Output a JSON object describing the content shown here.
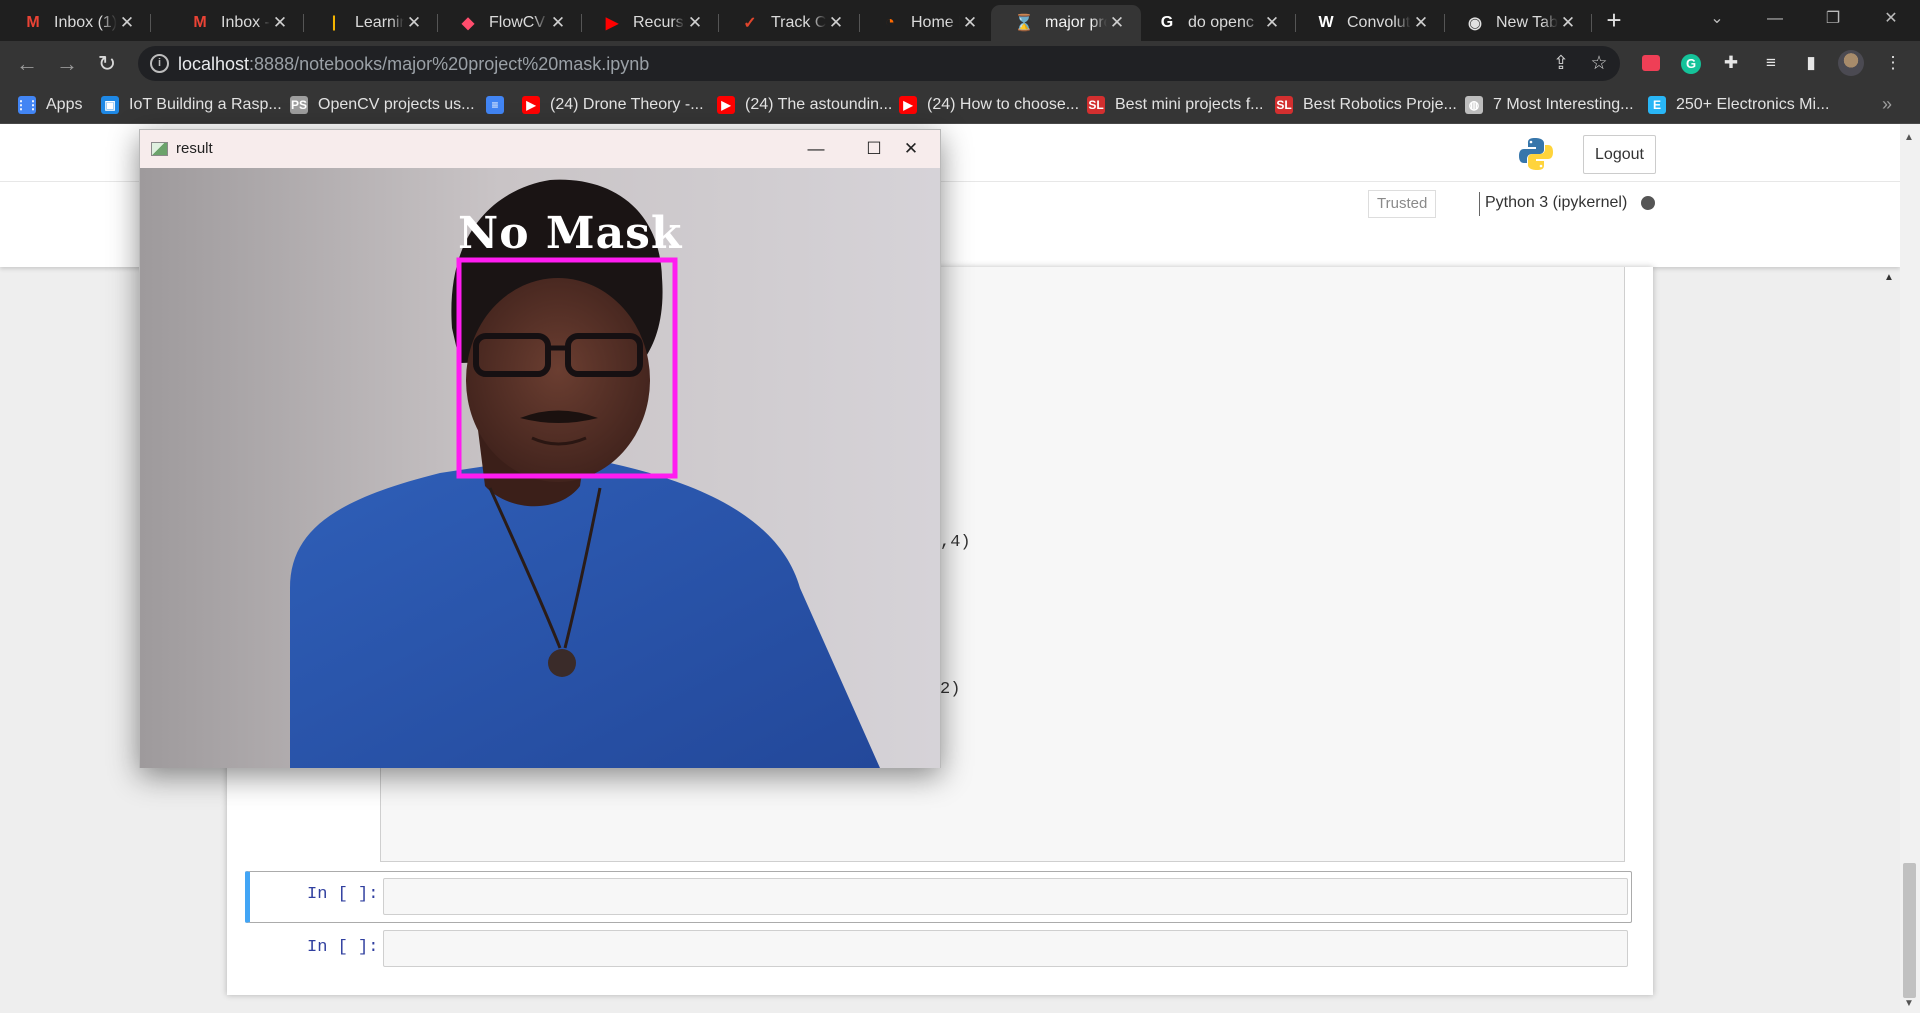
{
  "tabs": [
    {
      "title": "Inbox (1)",
      "icon": "gmail-icon",
      "color": "#ea4335",
      "glyph": "M"
    },
    {
      "title": "Inbox - va",
      "icon": "gmail-icon",
      "color": "#ea4335",
      "glyph": "M"
    },
    {
      "title": "Learning",
      "icon": "bar-chart-icon",
      "color": "#f4b400",
      "glyph": "|"
    },
    {
      "title": "FlowCV",
      "icon": "flowcv-icon",
      "color": "#ff4d6d",
      "glyph": "◆"
    },
    {
      "title": "Recursion",
      "icon": "youtube-icon",
      "color": "#ff0000",
      "glyph": "▶"
    },
    {
      "title": "Track Cor",
      "icon": "track-icon",
      "color": "#e0452c",
      "glyph": "✓"
    },
    {
      "title": "Home Pa",
      "icon": "circle-icon",
      "color": "#ff6a00",
      "glyph": "◔"
    },
    {
      "title": "major prc",
      "icon": "jupyter-icon",
      "color": "#f37626",
      "glyph": "⌛"
    },
    {
      "title": "do openc",
      "icon": "google-icon",
      "color": "#ffffff",
      "glyph": "G"
    },
    {
      "title": "Convoluti",
      "icon": "wikipedia-icon",
      "color": "#ffffff",
      "glyph": "W"
    },
    {
      "title": "New Tab",
      "icon": "chrome-icon",
      "color": "#e0e0e0",
      "glyph": "◉"
    }
  ],
  "address": {
    "host": "localhost",
    "rest": ":8888/notebooks/major%20project%20mask.ipynb"
  },
  "bookmarks": [
    {
      "label": "Apps",
      "icon": "apps-grid-icon",
      "color": "#4285f4",
      "glyph": "⋮⋮"
    },
    {
      "label": "IoT Building a Rasp...",
      "icon": "iot-icon",
      "color": "#1e88e5",
      "glyph": "▣"
    },
    {
      "label": "OpenCV projects us...",
      "icon": "opencv-icon",
      "color": "#9e9e9e",
      "glyph": "PS"
    },
    {
      "label": "",
      "icon": "docs-icon",
      "color": "#4285f4",
      "glyph": "≡"
    },
    {
      "label": "(24) Drone Theory -...",
      "icon": "youtube-icon",
      "color": "#ff0000",
      "glyph": "▶"
    },
    {
      "label": "(24) The astoundin...",
      "icon": "youtube-icon",
      "color": "#ff0000",
      "glyph": "▶"
    },
    {
      "label": "(24) How to choose...",
      "icon": "youtube-icon",
      "color": "#ff0000",
      "glyph": "▶"
    },
    {
      "label": "Best mini projects f...",
      "icon": "sl-icon",
      "color": "#d32f2f",
      "glyph": "SL"
    },
    {
      "label": "Best Robotics Proje...",
      "icon": "sl-icon",
      "color": "#d32f2f",
      "glyph": "SL"
    },
    {
      "label": "7 Most Interesting...",
      "icon": "globe-icon",
      "color": "#bdbdbd",
      "glyph": "◍"
    },
    {
      "label": "250+ Electronics Mi...",
      "icon": "electronics-icon",
      "color": "#29b6f6",
      "glyph": "E"
    }
  ],
  "jupyter": {
    "logout_label": "Logout",
    "trusted_label": "Trusted",
    "kernel_label": "Python 3 (ipykernel)",
    "code_fragment_1": ",4)",
    "code_fragment_2": "2)",
    "prompt_1": "In [ ]:",
    "prompt_2": "In [ ]:"
  },
  "cv_window": {
    "title": "result",
    "label": "No Mask",
    "box_color": "#ff1cf0"
  }
}
